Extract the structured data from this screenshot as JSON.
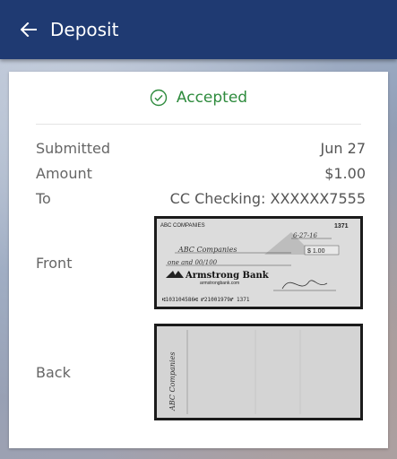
{
  "header": {
    "title": "Deposit"
  },
  "status": {
    "text": "Accepted",
    "color": "#2e8b3d"
  },
  "details": [
    {
      "label": "Submitted",
      "value": "Jun 27"
    },
    {
      "label": "Amount",
      "value": "$1.00"
    },
    {
      "label": "To",
      "value": "CC Checking: XXXXXX7555"
    }
  ],
  "images": {
    "front_label": "Front",
    "back_label": "Back"
  },
  "check": {
    "company": "ABC COMPANIES",
    "number": "1371",
    "date": "6-27-16",
    "payee": "ABC Companies",
    "amount": "$ 1.00",
    "written": "one and 00/100",
    "bank": "Armstrong Bank",
    "bank_site": "armstrongbank.com",
    "micr": "⑆103104586⑆ ⑈21001979⑈ 1371",
    "endorsement": "ABC Companies"
  },
  "colors": {
    "appbar": "#1f3a72",
    "accent": "#2e8b3d"
  }
}
